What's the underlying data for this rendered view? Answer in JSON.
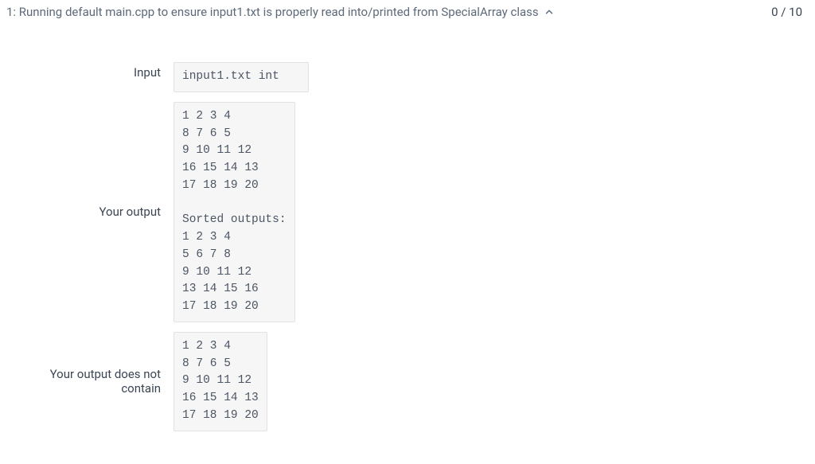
{
  "header": {
    "title": "1: Running default main.cpp to ensure input1.txt is properly read into/printed from SpecialArray class",
    "score": "0 / 10"
  },
  "rows": {
    "input": {
      "label": "Input",
      "value": "input1.txt int"
    },
    "your_output": {
      "label": "Your output",
      "value": "1 2 3 4\n8 7 6 5\n9 10 11 12\n16 15 14 13\n17 18 19 20\n\nSorted outputs:\n1 2 3 4\n5 6 7 8\n9 10 11 12\n13 14 15 16\n17 18 19 20"
    },
    "does_not_contain": {
      "label": "Your output does not contain",
      "value": "1 2 3 4\n8 7 6 5\n9 10 11 12\n16 15 14 13\n17 18 19 20"
    }
  }
}
